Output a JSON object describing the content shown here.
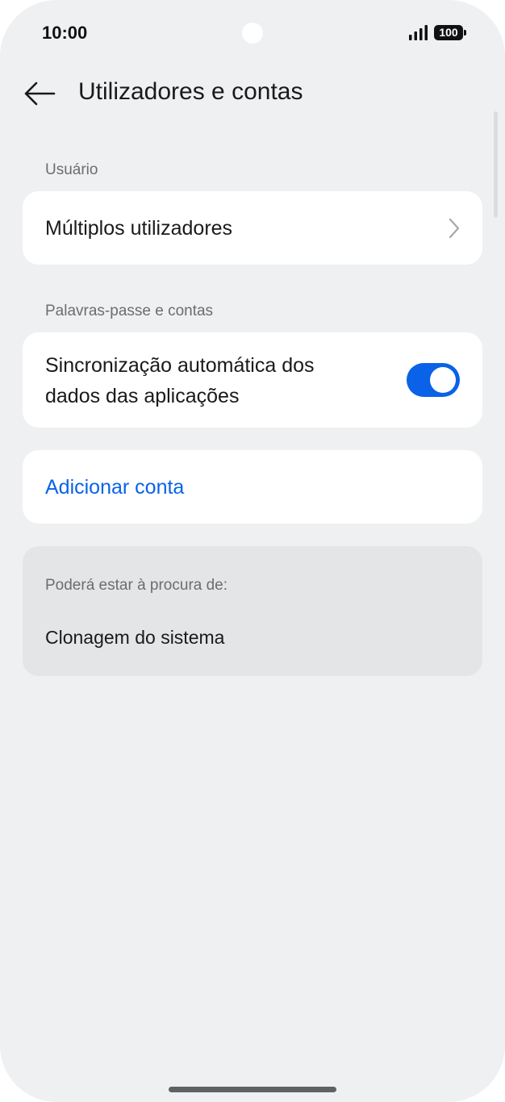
{
  "status_bar": {
    "time": "10:00",
    "battery": "100",
    "icons": [
      "signal-icon",
      "battery-icon"
    ]
  },
  "header": {
    "back_icon": "arrow-left-icon",
    "title": "Utilizadores e contas"
  },
  "sections": {
    "user": {
      "label": "Usuário",
      "items": [
        {
          "label": "Múltiplos utilizadores",
          "icon": "chevron-right-icon"
        }
      ]
    },
    "passwords": {
      "label": "Palavras-passe e contas",
      "auto_sync": {
        "line1": "Sincronização automática dos",
        "line2": "dados das aplicações",
        "enabled": true
      }
    },
    "add_account": {
      "label": "Adicionar conta"
    }
  },
  "suggestions": {
    "label": "Poderá estar à procura de:",
    "items": [
      "Clonagem do sistema"
    ]
  },
  "colors": {
    "background": "#eff0f2",
    "card": "#ffffff",
    "accent": "#0a62e8",
    "suggestion_card": "#e4e5e7",
    "secondary_text": "#6b6d70"
  }
}
